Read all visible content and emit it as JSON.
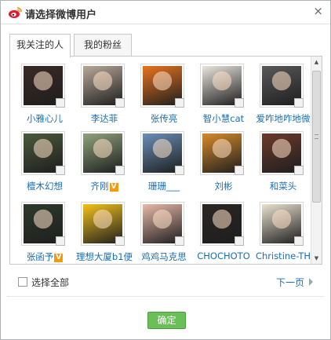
{
  "dialog": {
    "title": "请选择微博用户",
    "close_label": "×",
    "brand_color": "#e6162d"
  },
  "tabs": [
    {
      "label": "我关注的人",
      "active": true
    },
    {
      "label": "我的粉丝",
      "active": false
    }
  ],
  "users": [
    {
      "name": "小雅心儿",
      "verified": false,
      "color": "#3b2a26"
    },
    {
      "name": "李达菲",
      "verified": false,
      "color": "#b8a89a"
    },
    {
      "name": "张传亮",
      "verified": false,
      "color": "#e8741e"
    },
    {
      "name": "智小慧cat",
      "verified": false,
      "color": "#e9e5de"
    },
    {
      "name": "爱咋地咋地微",
      "verified": false,
      "color": "#5a5a5a"
    },
    {
      "name": "檀木幻想",
      "verified": false,
      "color": "#4b5a3c"
    },
    {
      "name": "齐刚",
      "verified": true,
      "color": "#8fa37c"
    },
    {
      "name": "珊珊___",
      "verified": false,
      "color": "#6a8fb8"
    },
    {
      "name": "刘彬",
      "verified": false,
      "color": "#d78b2a"
    },
    {
      "name": "和菜头",
      "verified": false,
      "color": "#6e3a2c"
    },
    {
      "name": "张函予",
      "verified": true,
      "color": "#2f3a2c"
    },
    {
      "name": "理想大厦b1便",
      "verified": false,
      "color": "#f2c21a"
    },
    {
      "name": "鸡鸡马克思",
      "verified": false,
      "color": "#e8b9a8"
    },
    {
      "name": "CHOCHOTO",
      "verified": false,
      "color": "#2a2624"
    },
    {
      "name": "Christine-TH",
      "verified": false,
      "color": "#e9e2cf"
    }
  ],
  "verified_badge": "V",
  "select_all_label": "选择全部",
  "next_page_label": "下一页",
  "confirm_label": "确定",
  "accent_green": "#6bbf59",
  "link_blue": "#1a6fb4"
}
